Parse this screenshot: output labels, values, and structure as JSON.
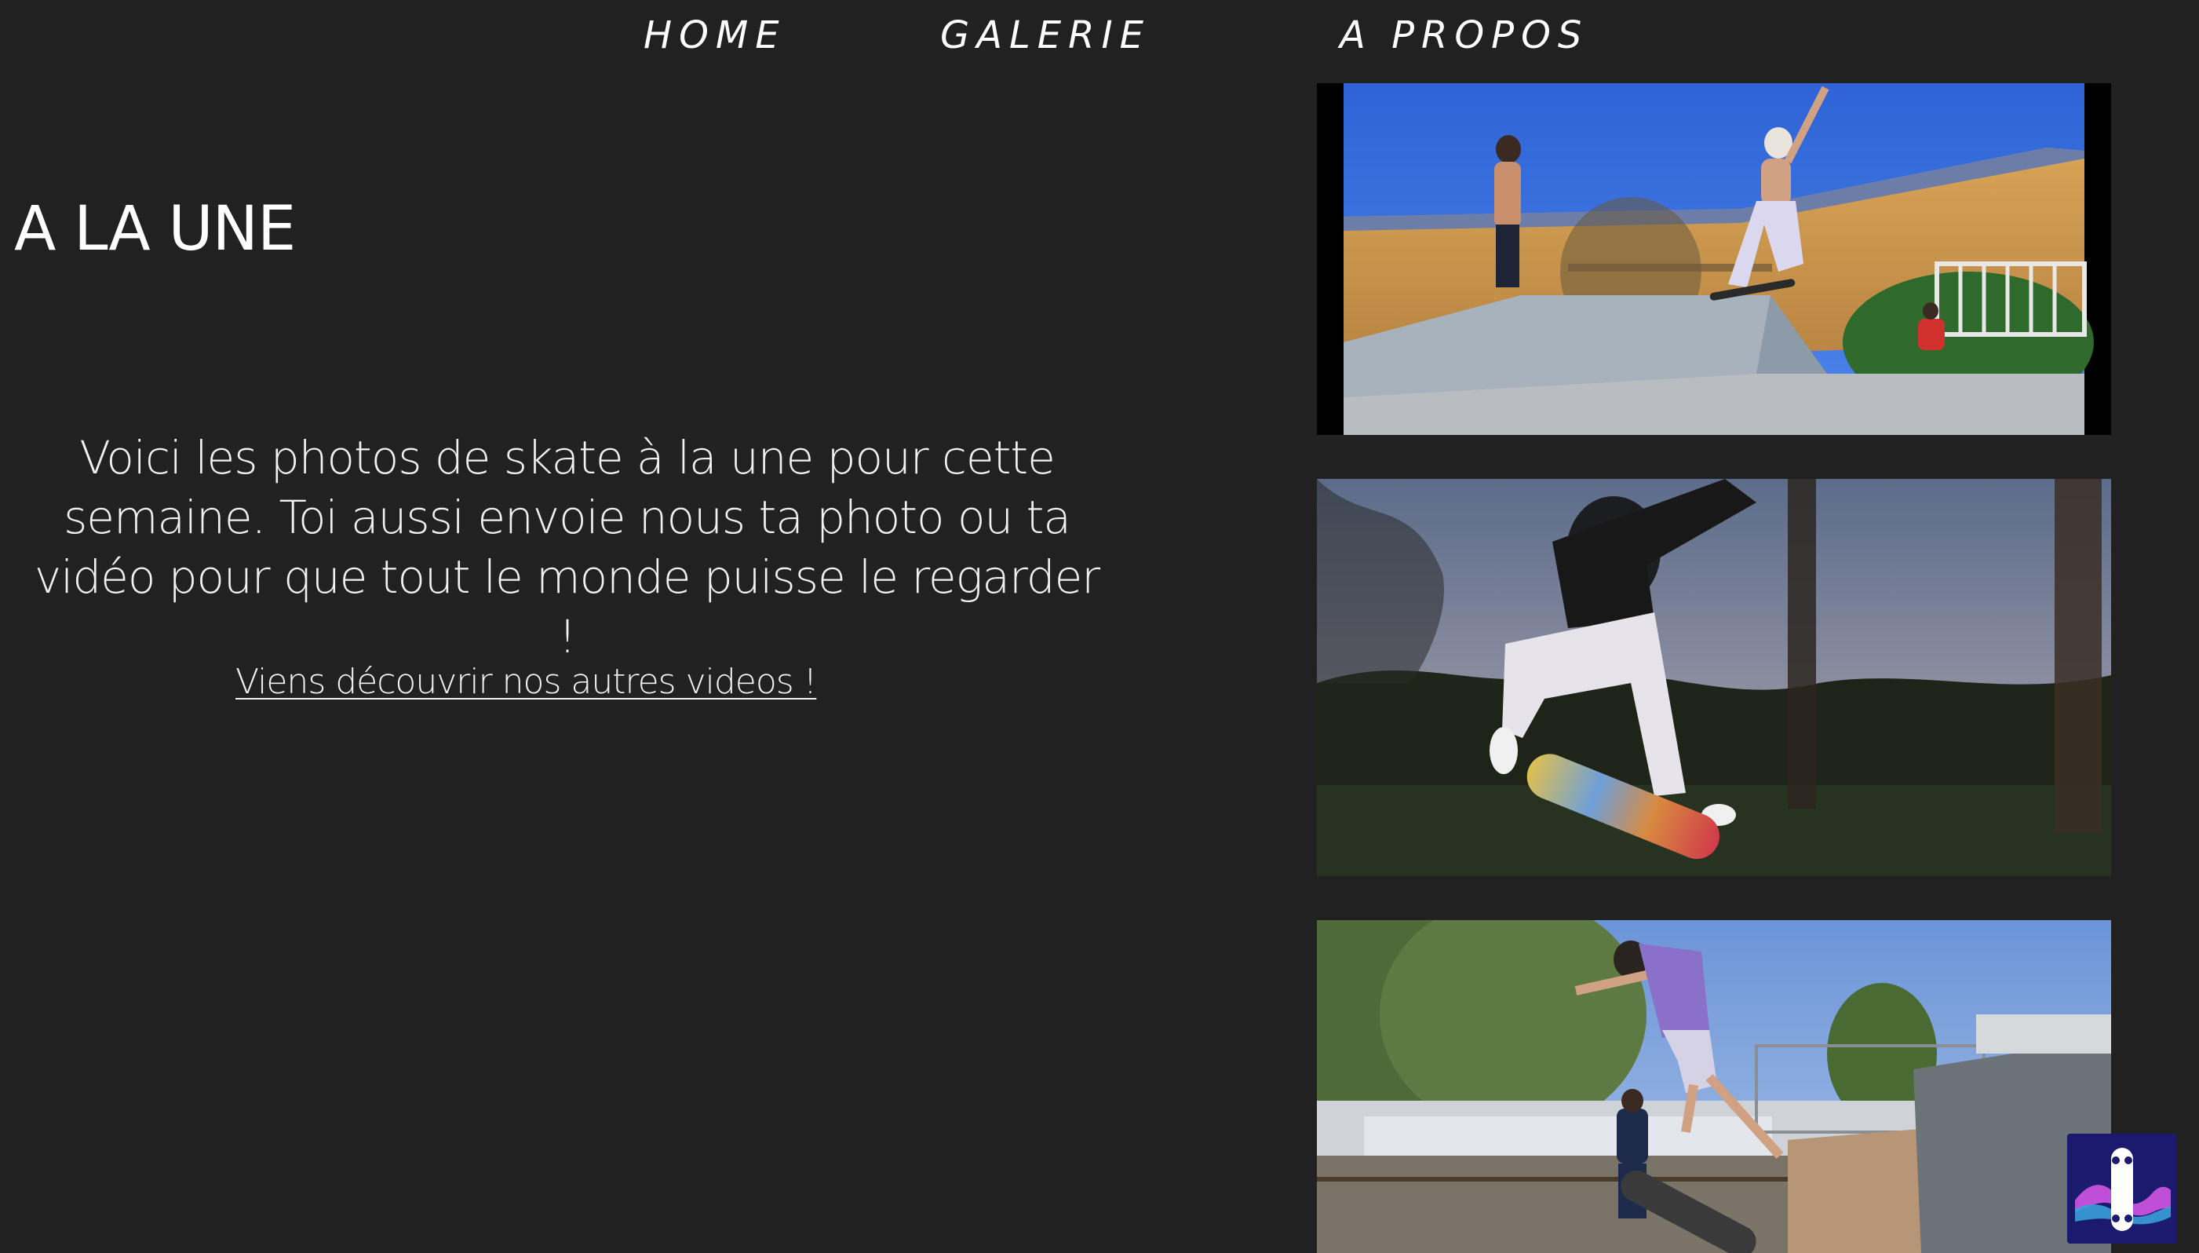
{
  "nav": {
    "home": "HOME",
    "galerie": "GALERIE",
    "apropos": "A PROPOS"
  },
  "main": {
    "headline": "A LA UNE",
    "intro": "Voici les photos de skate à la une pour cette semaine. Toi aussi envoie nous ta photo ou ta vidéo pour que tout le monde puisse le regarder !",
    "more_link": "Viens découvrir nos autres videos !"
  },
  "photos": [
    {
      "name": "skater-ollie-over-ramp-blue-sky"
    },
    {
      "name": "skater-kickflip-at-dusk"
    },
    {
      "name": "skater-in-purple-shirt-trick-skatepark"
    }
  ],
  "badge": {
    "icon": "skateboard-logo-icon"
  },
  "colors": {
    "background": "#212121",
    "text": "#ffffff",
    "badge": "#1c1a6e",
    "badge_wave": "#c04fd8"
  }
}
